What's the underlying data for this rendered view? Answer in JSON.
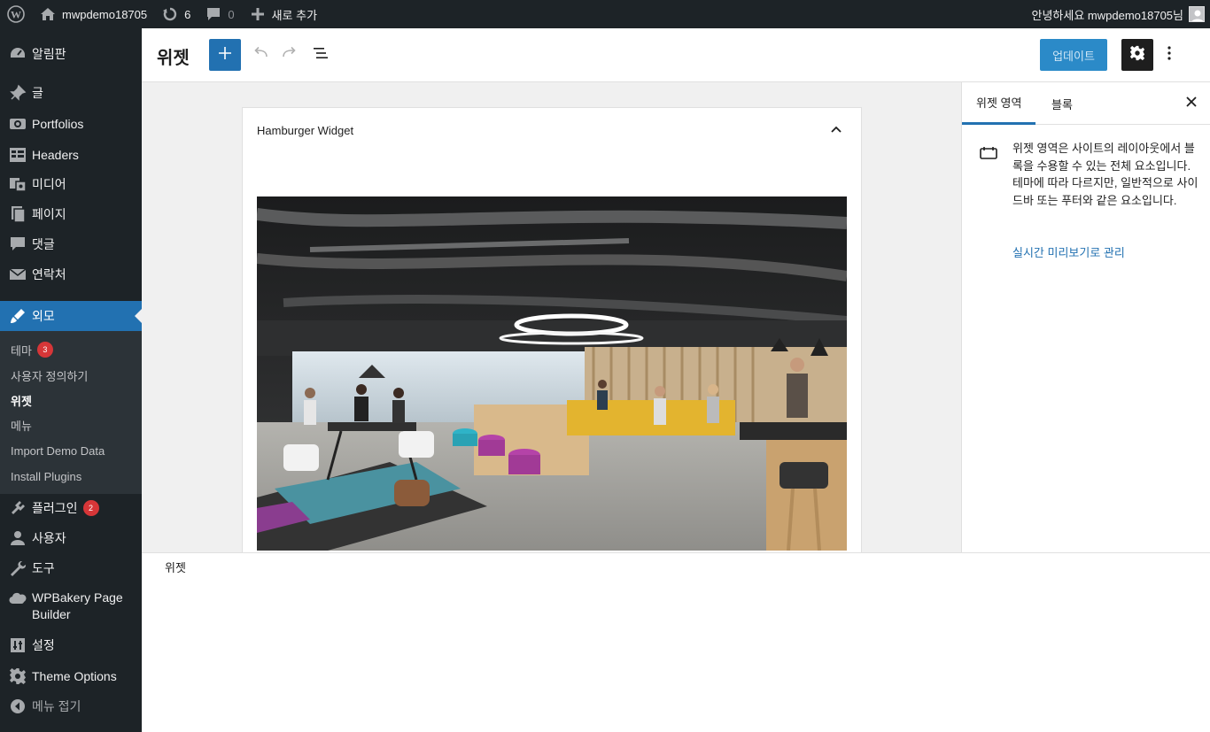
{
  "adminbar": {
    "site_name": "mwpdemo18705",
    "updates_count": "6",
    "comments_count": "0",
    "new_label": "새로 추가",
    "greeting": "안녕하세요 mwpdemo18705님"
  },
  "sidebar": {
    "items": [
      {
        "label": "알림판",
        "icon": "dashboard-icon"
      },
      {
        "label": "글",
        "icon": "pin-icon"
      },
      {
        "label": "Portfolios",
        "icon": "portfolio-icon"
      },
      {
        "label": "Headers",
        "icon": "headers-icon"
      },
      {
        "label": "미디어",
        "icon": "media-icon"
      },
      {
        "label": "페이지",
        "icon": "pages-icon"
      },
      {
        "label": "댓글",
        "icon": "comments-icon"
      },
      {
        "label": "연락처",
        "icon": "mail-icon"
      },
      {
        "label": "외모",
        "icon": "appearance-icon"
      },
      {
        "label": "플러그인",
        "icon": "plugin-icon",
        "badge": "2"
      },
      {
        "label": "사용자",
        "icon": "users-icon"
      },
      {
        "label": "도구",
        "icon": "tools-icon"
      },
      {
        "label": "WPBakery Page Builder",
        "icon": "wpbakery-icon"
      },
      {
        "label": "설정",
        "icon": "settings-icon"
      },
      {
        "label": "Theme Options",
        "icon": "gear-icon"
      },
      {
        "label": "메뉴 접기",
        "icon": "collapse-icon"
      }
    ],
    "submenu": [
      {
        "label": "테마",
        "badge": "3"
      },
      {
        "label": "사용자 정의하기"
      },
      {
        "label": "위젯"
      },
      {
        "label": "메뉴"
      },
      {
        "label": "Import Demo Data"
      },
      {
        "label": "Install Plugins"
      }
    ]
  },
  "header": {
    "title": "위젯",
    "update_label": "업데이트"
  },
  "canvas": {
    "widget_title": "Hamburger Widget"
  },
  "panel": {
    "tab_area": "위젯 영역",
    "tab_block": "블록",
    "description": "위젯 영역은 사이트의 레이아웃에서 블록을 수용할 수 있는 전체 요소입니다. 테마에 따라 다르지만, 일반적으로 사이드바 또는 푸터와 같은 요소입니다.",
    "link": "실시간 미리보기로 관리"
  },
  "footer": {
    "breadcrumb": "위젯"
  },
  "colors": {
    "admin_dark": "#1d2327",
    "accent": "#2271b1",
    "badge": "#d63638"
  }
}
